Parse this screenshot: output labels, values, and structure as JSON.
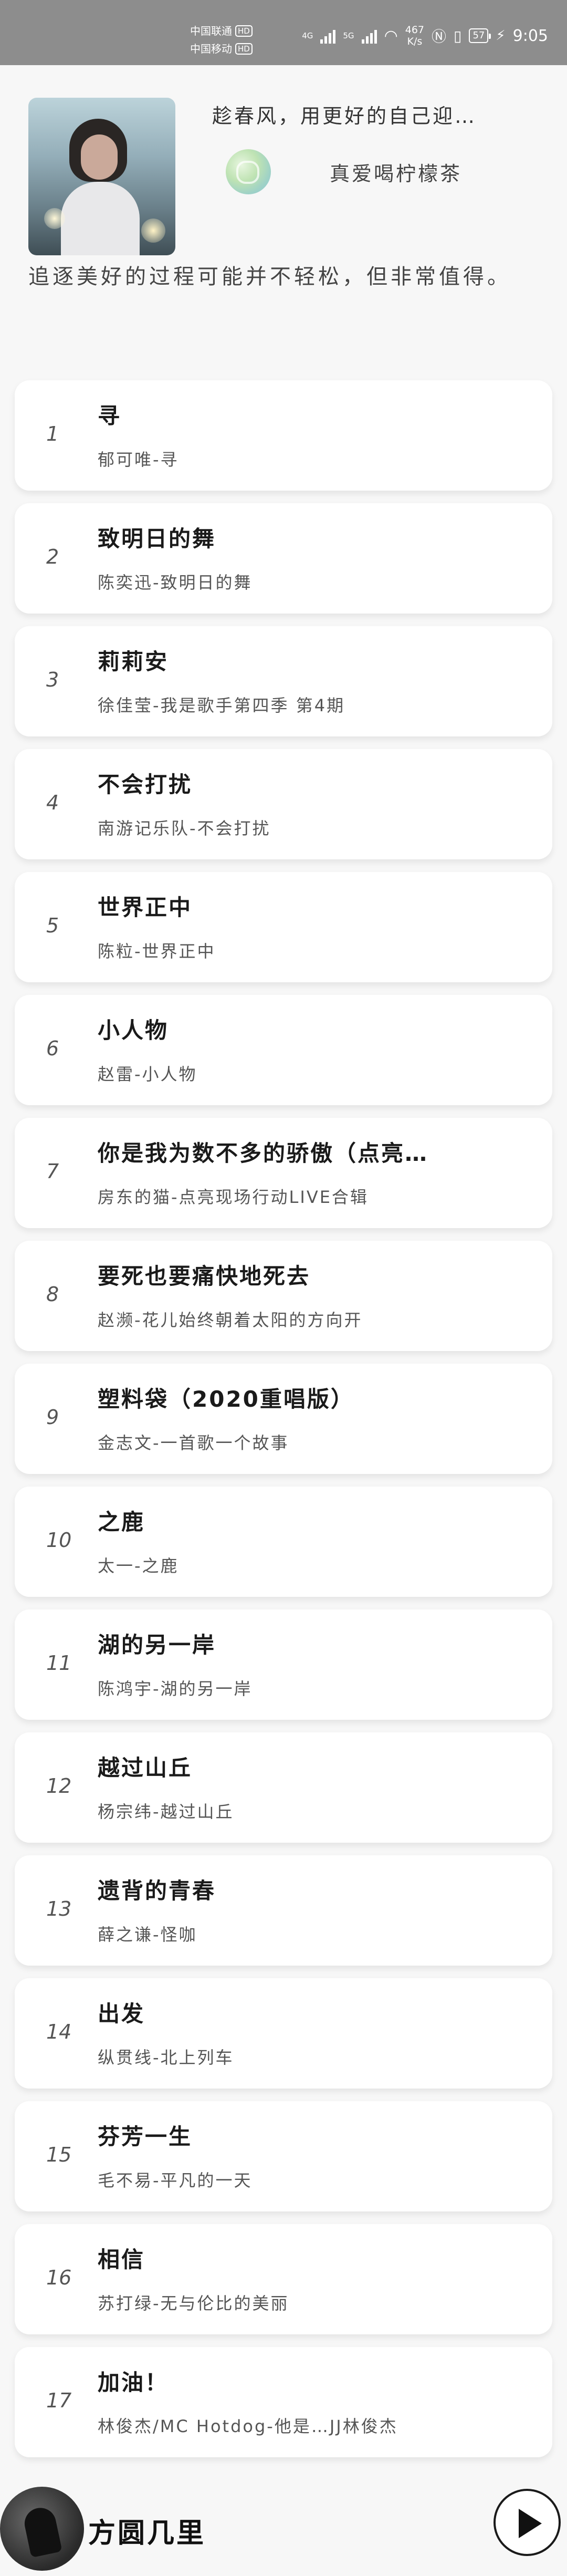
{
  "status_bar": {
    "carrier1": "中国联通",
    "carrier2": "中国移动",
    "hd": "HD",
    "net1": "4G",
    "net2": "5G",
    "speed_value": "467",
    "speed_unit": "K/s",
    "battery": "57",
    "time": "9:05"
  },
  "profile": {
    "header_title": "趁春风，用更好的自己迎…",
    "user_name": "真爱喝柠檬茶",
    "motto": "追逐美好的过程可能并不轻松，但非常值得。"
  },
  "songs": [
    {
      "index": "1",
      "title": "寻",
      "subtitle": "郁可唯-寻"
    },
    {
      "index": "2",
      "title": "致明日的舞",
      "subtitle": "陈奕迅-致明日的舞"
    },
    {
      "index": "3",
      "title": "莉莉安",
      "subtitle": "徐佳莹-我是歌手第四季 第4期"
    },
    {
      "index": "4",
      "title": "不会打扰",
      "subtitle": "南游记乐队-不会打扰"
    },
    {
      "index": "5",
      "title": "世界正中",
      "subtitle": "陈粒-世界正中"
    },
    {
      "index": "6",
      "title": "小人物",
      "subtitle": "赵雷-小人物"
    },
    {
      "index": "7",
      "title": "你是我为数不多的骄傲（点亮…",
      "subtitle": "房东的猫-点亮现场行动LIVE合辑"
    },
    {
      "index": "8",
      "title": "要死也要痛快地死去",
      "subtitle": "赵濒-花儿始终朝着太阳的方向开"
    },
    {
      "index": "9",
      "title": "塑料袋（2020重唱版）",
      "subtitle": "金志文-一首歌一个故事"
    },
    {
      "index": "10",
      "title": "之鹿",
      "subtitle": "太一-之鹿"
    },
    {
      "index": "11",
      "title": "湖的另一岸",
      "subtitle": "陈鸿宇-湖的另一岸"
    },
    {
      "index": "12",
      "title": "越过山丘",
      "subtitle": "杨宗纬-越过山丘"
    },
    {
      "index": "13",
      "title": "遗背的青春",
      "subtitle": "薛之谦-怪咖"
    },
    {
      "index": "14",
      "title": "出发",
      "subtitle": "纵贯线-北上列车"
    },
    {
      "index": "15",
      "title": "芬芳一生",
      "subtitle": "毛不易-平凡的一天"
    },
    {
      "index": "16",
      "title": "相信",
      "subtitle": "苏打绿-无与伦比的美丽"
    },
    {
      "index": "17",
      "title": "加油！",
      "subtitle": "林俊杰/MC Hotdog-他是…JJ林俊杰"
    }
  ],
  "player": {
    "now_playing_title": "方圆几里",
    "play_icon": "play-icon"
  }
}
